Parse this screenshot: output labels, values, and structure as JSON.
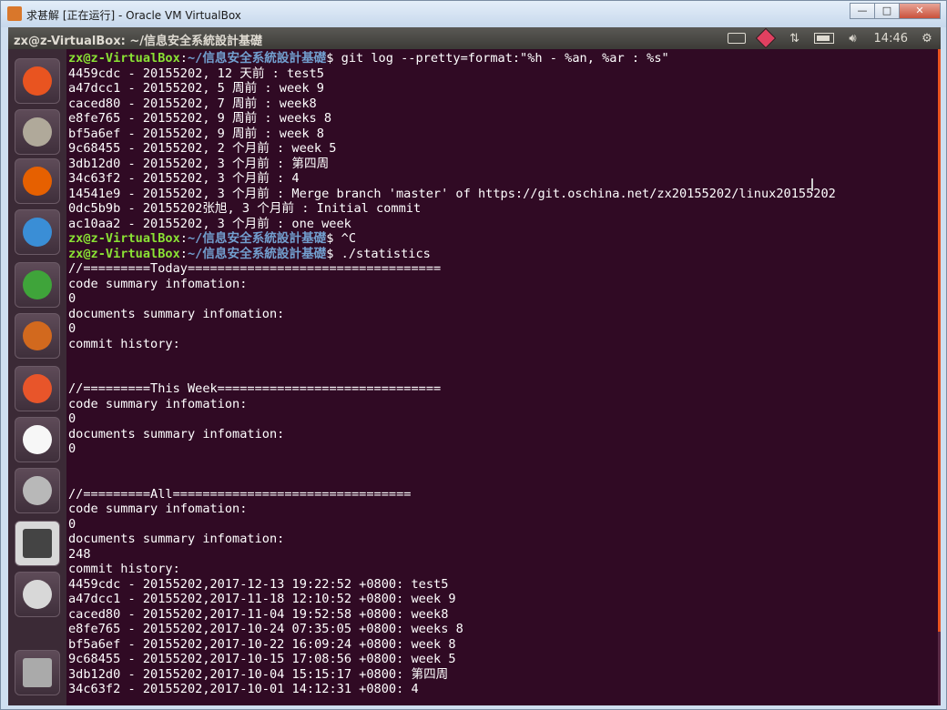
{
  "window": {
    "title": "求甚解 [正在运行] - Oracle VM VirtualBox",
    "buttons": [
      "—",
      "□",
      "✕"
    ]
  },
  "panel": {
    "title": "zx@z-VirtualBox: ~/信息安全系統設計基礎",
    "clock": "14:46"
  },
  "launcher": [
    {
      "name": "dash-home-icon",
      "color": "#e95420"
    },
    {
      "name": "files-icon",
      "color": "#b0a99a"
    },
    {
      "name": "firefox-icon",
      "color": "#e66000"
    },
    {
      "name": "writer-icon",
      "color": "#3a8ed6"
    },
    {
      "name": "calc-icon",
      "color": "#3fa43a"
    },
    {
      "name": "impress-icon",
      "color": "#d2691e"
    },
    {
      "name": "software-center-icon",
      "color": "#e8552a"
    },
    {
      "name": "amazon-icon",
      "color": "#f7f7f7"
    },
    {
      "name": "settings-icon",
      "color": "#b8b8b8"
    },
    {
      "name": "terminal-icon",
      "color": "#444444"
    },
    {
      "name": "dvd-icon",
      "color": "#d8d8d8"
    },
    {
      "name": "trash-icon",
      "color": "#aaaaaa"
    }
  ],
  "terminal": {
    "prompt_user": "zx@z-VirtualBox",
    "prompt_path": "~/信息安全系統設計基礎",
    "block1": {
      "cmd": " git log --pretty=format:\"%h - %an, %ar : %s\"",
      "output": "4459cdc - 20155202, 12 天前 : test5\na47dcc1 - 20155202, 5 周前 : week 9\ncaced80 - 20155202, 7 周前 : week8\ne8fe765 - 20155202, 9 周前 : weeks 8\nbf5a6ef - 20155202, 9 周前 : week 8\n9c68455 - 20155202, 2 个月前 : week 5\n3db12d0 - 20155202, 3 个月前 : 第四周\n34c63f2 - 20155202, 3 个月前 : 4\n14541e9 - 20155202, 3 个月前 : Merge branch 'master' of https://git.oschina.net/zx20155202/linux20155202\n0dc5b9b - 20155202张旭, 3 个月前 : Initial commit\nac10aa2 - 20155202, 3 个月前 : one week"
    },
    "block2": {
      "cmd": " ^C"
    },
    "block3": {
      "cmd": " ./statistics",
      "output": "//=========Today==================================\ncode summary infomation:\n0\ndocuments summary infomation:\n0\ncommit history:\n\n\n//=========This Week==============================\ncode summary infomation:\n0\ndocuments summary infomation:\n0\n\n\n//=========All================================\ncode summary infomation:\n0\ndocuments summary infomation:\n248\ncommit history:\n4459cdc - 20155202,2017-12-13 19:22:52 +0800: test5\na47dcc1 - 20155202,2017-11-18 12:10:52 +0800: week 9\ncaced80 - 20155202,2017-11-04 19:52:58 +0800: week8\ne8fe765 - 20155202,2017-10-24 07:35:05 +0800: weeks 8\nbf5a6ef - 20155202,2017-10-22 16:09:24 +0800: week 8\n9c68455 - 20155202,2017-10-15 17:08:56 +0800: week 5\n3db12d0 - 20155202,2017-10-04 15:15:17 +0800: 第四周\n34c63f2 - 20155202,2017-10-01 14:12:31 +0800: 4"
    }
  }
}
